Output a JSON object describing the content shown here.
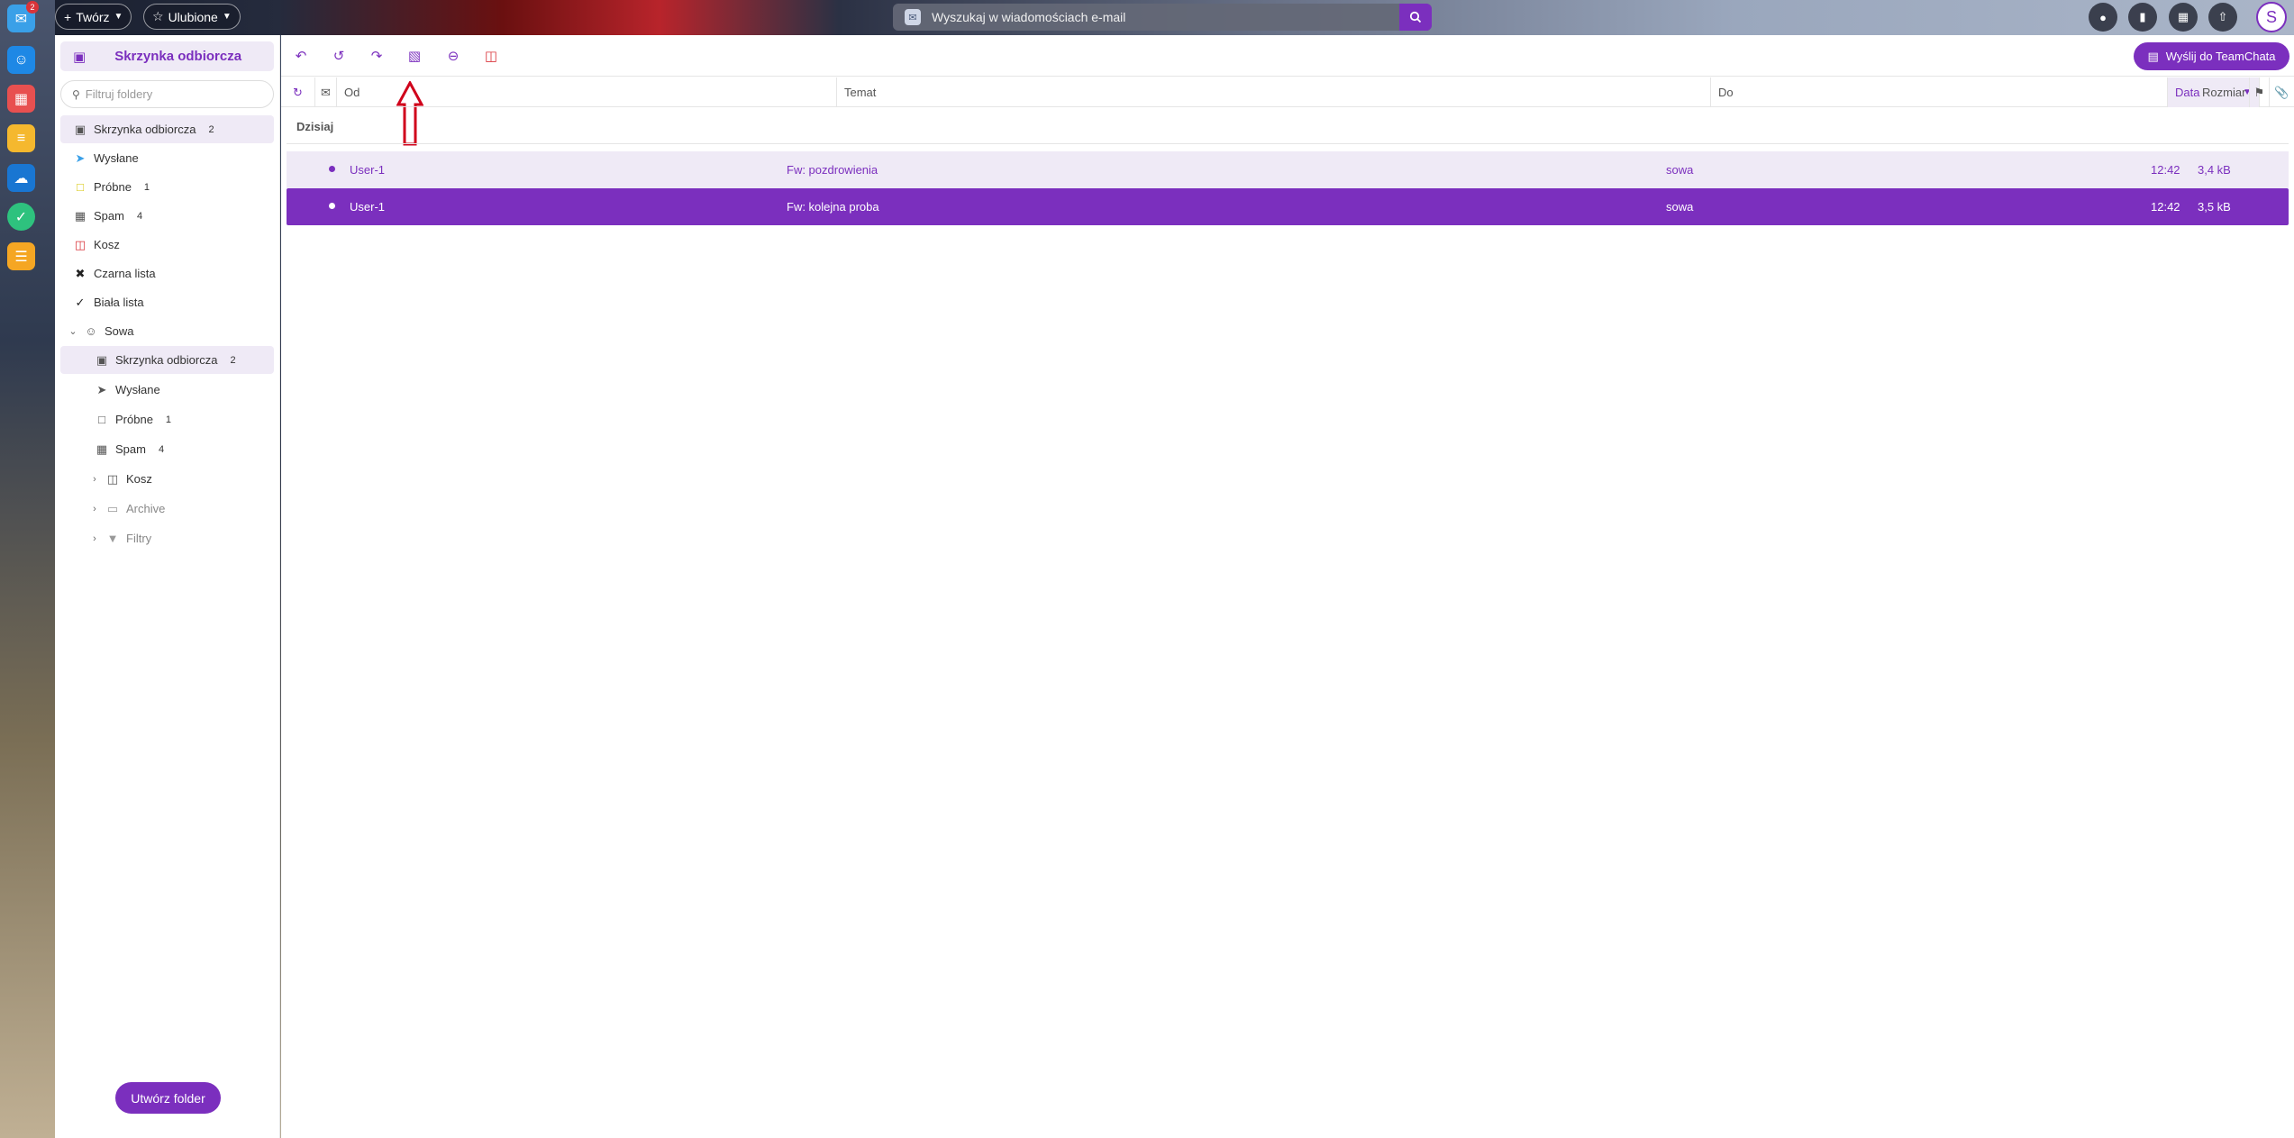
{
  "dock": {
    "badge": "2",
    "apps": [
      {
        "name": "mail-app-icon",
        "color": "#3aa0e8",
        "glyph": "✉"
      },
      {
        "name": "contacts-app-icon",
        "color": "#1e88e5",
        "glyph": "☺"
      },
      {
        "name": "calendar-app-icon",
        "color": "#e85050",
        "glyph": "▦"
      },
      {
        "name": "notes-app-icon",
        "color": "#f5b82e",
        "glyph": "≡"
      },
      {
        "name": "drive-app-icon",
        "color": "#1976d2",
        "glyph": "☁"
      },
      {
        "name": "tasks-app-icon",
        "color": "#2ec27e",
        "glyph": "✓"
      },
      {
        "name": "files-app-icon",
        "color": "#f5a623",
        "glyph": "☰"
      }
    ]
  },
  "topbar": {
    "create_label": "Twórz",
    "favorites_label": "Ulubione",
    "search_placeholder": "Wyszukaj w wiadomościach e-mail",
    "avatar_letter": "S"
  },
  "folders": {
    "header": "Skrzynka odbiorcza",
    "filter_placeholder": "Filtruj foldery",
    "items": [
      {
        "label": "Skrzynka odbiorcza",
        "count": "2"
      },
      {
        "label": "Wysłane",
        "count": ""
      },
      {
        "label": "Próbne",
        "count": "1"
      },
      {
        "label": "Spam",
        "count": "4"
      },
      {
        "label": "Kosz",
        "count": ""
      },
      {
        "label": "Czarna lista",
        "count": ""
      },
      {
        "label": "Biała lista",
        "count": ""
      },
      {
        "label": "Sowa",
        "count": ""
      },
      {
        "label": "Skrzynka odbiorcza",
        "count": "2"
      },
      {
        "label": "Wysłane",
        "count": ""
      },
      {
        "label": "Próbne",
        "count": "1"
      },
      {
        "label": "Spam",
        "count": "4"
      },
      {
        "label": "Kosz",
        "count": ""
      },
      {
        "label": "Archive",
        "count": ""
      },
      {
        "label": "Filtry",
        "count": ""
      }
    ],
    "create_folder_label": "Utwórz folder"
  },
  "toolbar": {
    "teamchat_label": "Wyślij do TeamChata"
  },
  "columns": {
    "from": "Od",
    "subject": "Temat",
    "to": "Do",
    "date": "Data",
    "size": "Rozmiar"
  },
  "group_label": "Dzisiaj",
  "messages": [
    {
      "from": "User-1",
      "subject": "Fw: pozdrowienia",
      "to": "sowa",
      "time": "12:42",
      "size": "3,4 kB",
      "state": "unread"
    },
    {
      "from": "User-1",
      "subject": "Fw: kolejna proba",
      "to": "sowa",
      "time": "12:42",
      "size": "3,5 kB",
      "state": "selected"
    }
  ],
  "colors": {
    "accent": "#7b2fbe",
    "selection_bg": "#efeaf6",
    "delete": "#d9343a",
    "annotation_arrow": "#d0021b"
  }
}
